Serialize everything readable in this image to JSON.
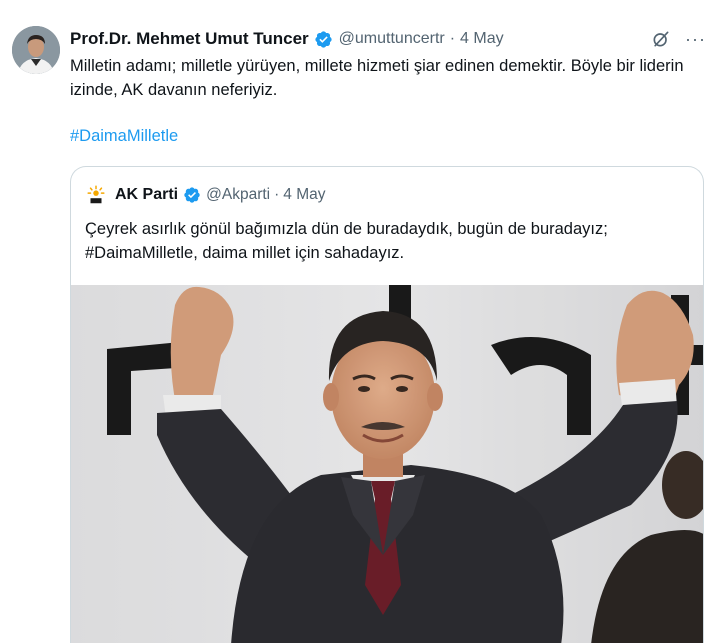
{
  "tweet": {
    "author": {
      "display_name": "Prof.Dr. Mehmet Umut Tuncer",
      "handle": "@umuttuncertr",
      "verified_icon": "verified-badge-icon",
      "avatar_icon": "avatar"
    },
    "separator": "·",
    "date": "4 May",
    "grok_icon": "grok-icon",
    "more_icon": "more-icon",
    "more_label": "···",
    "text": "Milletin adamı; milletle yürüyen, millete hizmeti şiar edinen demektir. Böyle bir liderin izinde, AK davanın neferiyiz.",
    "hashtag": "#DaimaMilletle"
  },
  "quote": {
    "author": {
      "display_name": "AK Parti",
      "handle": "@Akparti",
      "logo_icon": "ak-parti-logo-icon",
      "verified_icon": "verified-badge-icon"
    },
    "separator": "·",
    "date": "4 May",
    "text_line1": "Çeyrek asırlık gönül bağımızla dün de buradaydık, bugün de buradayız;",
    "text_line2": "#DaimaMilletle, daima millet için sahadayız.",
    "image": "photo-man-waving-both-hands"
  },
  "colors": {
    "link": "#1d9bf0",
    "text": "#0f1419",
    "secondary": "#536471",
    "border": "#cfd9de",
    "verified": "#1d9bf0"
  }
}
